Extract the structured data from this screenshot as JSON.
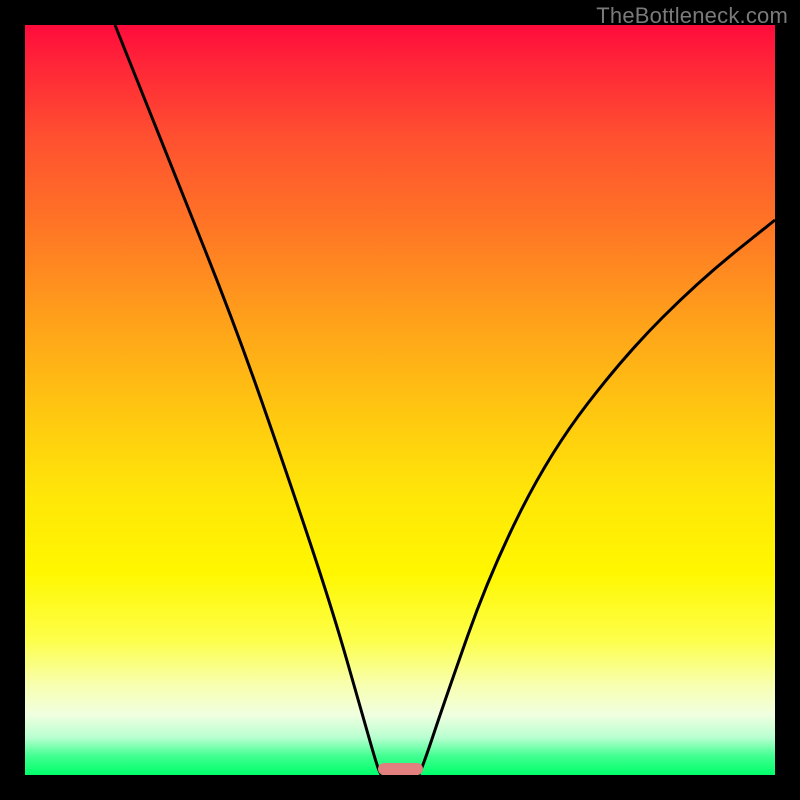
{
  "watermark": "TheBottleneck.com",
  "chart_data": {
    "type": "line",
    "title": "",
    "xlabel": "",
    "ylabel": "",
    "xlim": [
      0,
      100
    ],
    "ylim": [
      0,
      100
    ],
    "curve_left": [
      {
        "x": 12,
        "y": 100
      },
      {
        "x": 20,
        "y": 80
      },
      {
        "x": 28,
        "y": 60
      },
      {
        "x": 35,
        "y": 40
      },
      {
        "x": 41,
        "y": 22
      },
      {
        "x": 45,
        "y": 8
      },
      {
        "x": 47,
        "y": 1
      },
      {
        "x": 47.5,
        "y": 0
      }
    ],
    "curve_right": [
      {
        "x": 52.5,
        "y": 0
      },
      {
        "x": 53,
        "y": 1
      },
      {
        "x": 56,
        "y": 10
      },
      {
        "x": 62,
        "y": 27
      },
      {
        "x": 70,
        "y": 43
      },
      {
        "x": 80,
        "y": 56
      },
      {
        "x": 90,
        "y": 66
      },
      {
        "x": 100,
        "y": 74
      }
    ],
    "marker": {
      "x_start": 47,
      "x_end": 53,
      "y": 0
    },
    "gradient_stops": [
      {
        "pos": 0,
        "color": "#ff0b3c"
      },
      {
        "pos": 50,
        "color": "#ffd000"
      },
      {
        "pos": 100,
        "color": "#00ff6a"
      }
    ]
  }
}
